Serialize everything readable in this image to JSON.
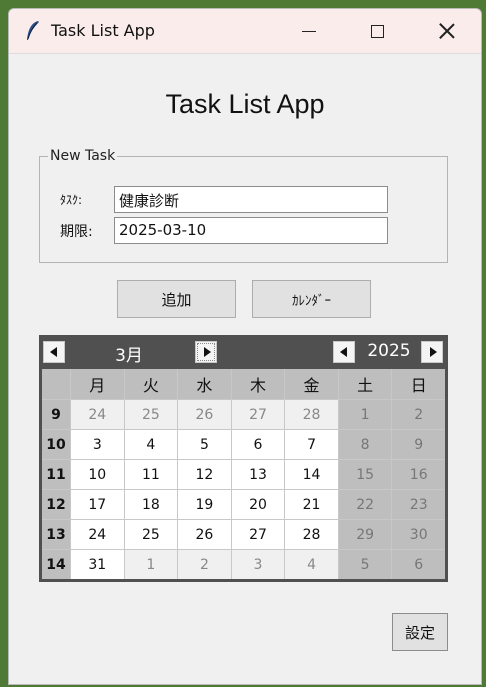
{
  "window": {
    "title": "Task List App"
  },
  "app": {
    "heading": "Task List App"
  },
  "new_task": {
    "legend": "New Task",
    "task_label": "ﾀｽｸ:",
    "task_value": "健康診断",
    "due_label": "期限:",
    "due_value": "2025-03-10"
  },
  "buttons": {
    "add": "追加",
    "calendar": "ｶﾚﾝﾀﾞｰ",
    "settings": "設定"
  },
  "calendar": {
    "month": "3月",
    "year": "2025",
    "weekday_headers": [
      "月",
      "火",
      "水",
      "木",
      "金",
      "土",
      "日"
    ],
    "weeks": [
      {
        "num": "9",
        "days": [
          "24",
          "25",
          "26",
          "27",
          "28",
          "1",
          "2"
        ],
        "kinds": [
          "oth",
          "oth",
          "oth",
          "oth",
          "oth",
          "we",
          "we"
        ]
      },
      {
        "num": "10",
        "days": [
          "3",
          "4",
          "5",
          "6",
          "7",
          "8",
          "9"
        ],
        "kinds": [
          "cur",
          "cur",
          "cur",
          "cur",
          "cur",
          "we",
          "we"
        ]
      },
      {
        "num": "11",
        "days": [
          "10",
          "11",
          "12",
          "13",
          "14",
          "15",
          "16"
        ],
        "kinds": [
          "cur",
          "cur",
          "cur",
          "cur",
          "cur",
          "we",
          "we"
        ]
      },
      {
        "num": "12",
        "days": [
          "17",
          "18",
          "19",
          "20",
          "21",
          "22",
          "23"
        ],
        "kinds": [
          "cur",
          "cur",
          "cur",
          "cur",
          "cur",
          "we",
          "we"
        ]
      },
      {
        "num": "13",
        "days": [
          "24",
          "25",
          "26",
          "27",
          "28",
          "29",
          "30"
        ],
        "kinds": [
          "cur",
          "cur",
          "cur",
          "cur",
          "cur",
          "we",
          "we"
        ]
      },
      {
        "num": "14",
        "days": [
          "31",
          "1",
          "2",
          "3",
          "4",
          "5",
          "6"
        ],
        "kinds": [
          "cur",
          "oth",
          "oth",
          "oth",
          "oth",
          "we",
          "we"
        ]
      }
    ]
  },
  "icons": {
    "app": "feather-icon",
    "minimize": "minimize-icon",
    "maximize": "maximize-icon",
    "close": "close-icon",
    "prev": "left-arrow-icon",
    "next": "right-arrow-icon"
  },
  "colors": {
    "titlebar": "#f9ecea",
    "calendar_header": "#505050",
    "desktop": "#4f7a36"
  }
}
